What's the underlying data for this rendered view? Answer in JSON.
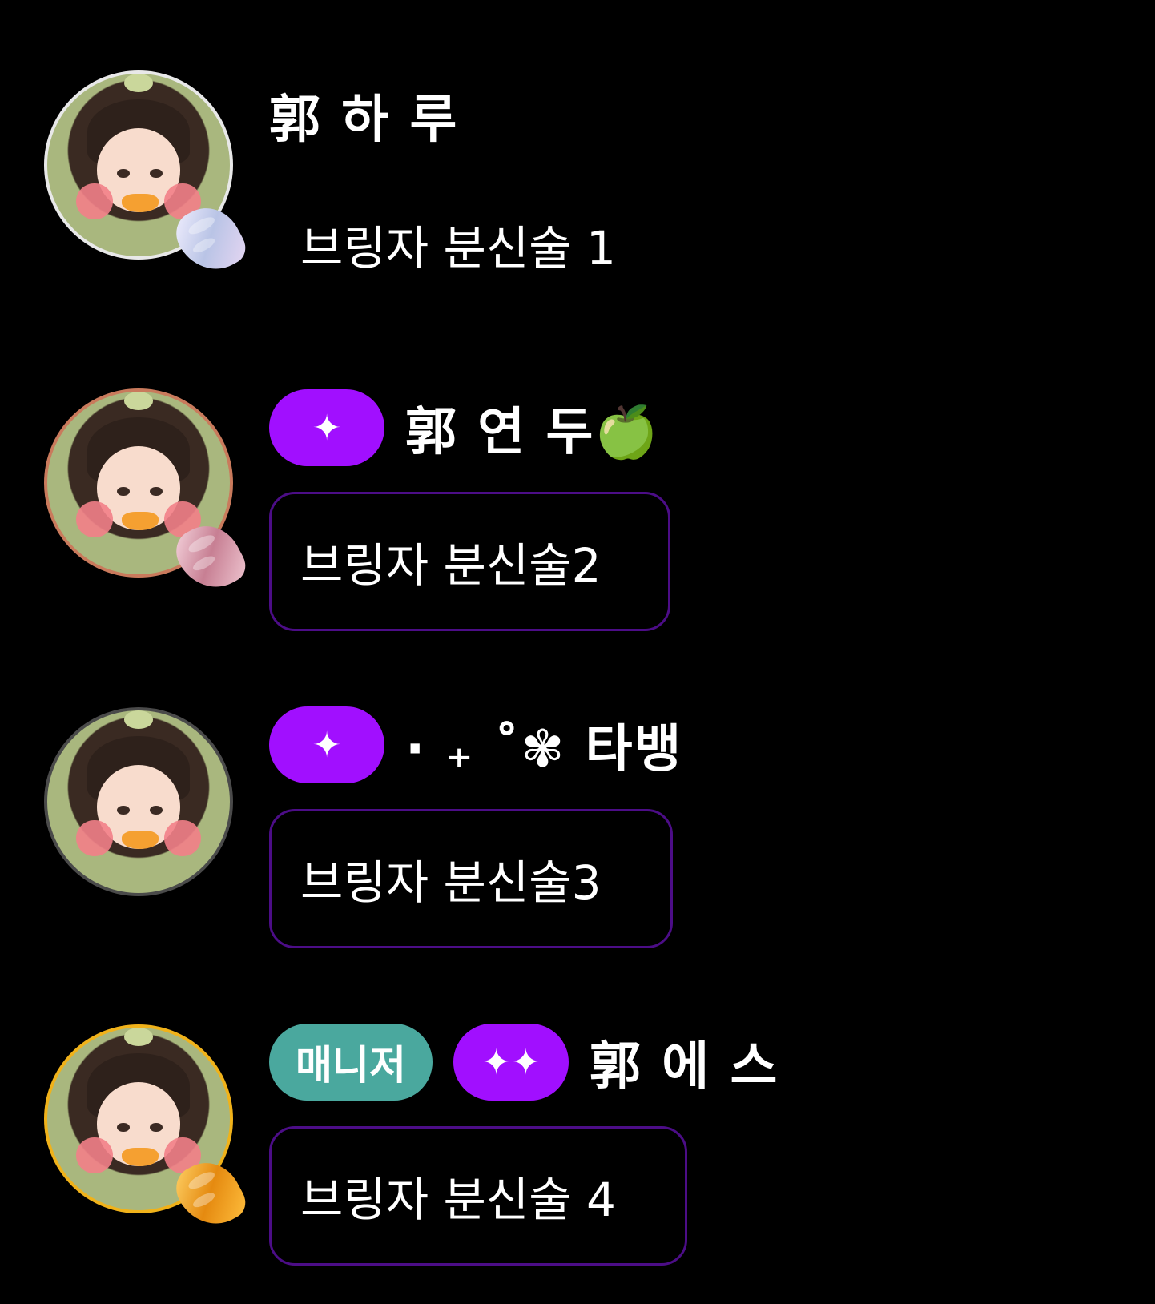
{
  "messages": [
    {
      "name": "郭 하 루",
      "badges": [],
      "text": "브링자 분신술 1",
      "frame_color": "#e8e8e8",
      "wing_color": "#d9d4ef"
    },
    {
      "name": "郭 연 두🍏",
      "badges": [
        {
          "label": "✦",
          "color": "#a10fff"
        }
      ],
      "text": "브링자 분신술2",
      "frame_color": "#c97a5c",
      "wing_color": "#d7a7b4"
    },
    {
      "name": "· ₊ ˚✾ 타뱅",
      "badges": [
        {
          "label": "✦",
          "color": "#a10fff"
        }
      ],
      "text": "브링자 분신술3",
      "frame_color": "#4a4a4a",
      "wing_color": ""
    },
    {
      "name": "郭 에 스",
      "badges": [
        {
          "label": "매니저",
          "color": "#4aa89e"
        },
        {
          "label": "✦✦",
          "color": "#a10fff"
        }
      ],
      "text": "브링자 분신술 4",
      "frame_color": "#f0b21a",
      "wing_color": "#f2a01e"
    }
  ],
  "colors": {
    "background": "#000000",
    "bubble_border": "#4c0d87",
    "star_badge": "#a10fff",
    "manager_badge": "#4aa89e"
  }
}
